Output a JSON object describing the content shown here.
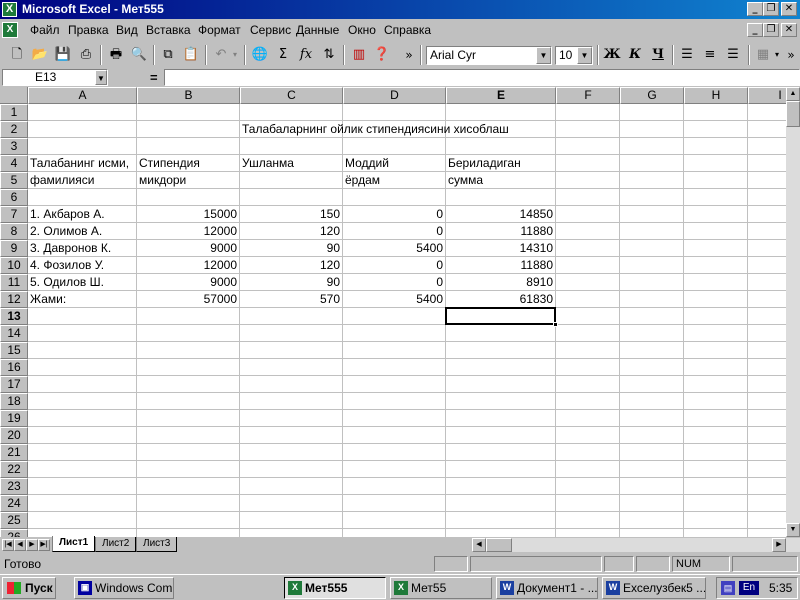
{
  "window": {
    "title": "Microsoft Excel - Мет555",
    "app_icon": "excel-icon",
    "controls": [
      "_",
      "❐",
      "✕"
    ]
  },
  "menu": {
    "items": [
      "Файл",
      "Правка",
      "Вид",
      "Вставка",
      "Формат",
      "Сервис",
      "Данные",
      "Окно",
      "Справка"
    ],
    "doc_controls": [
      "_",
      "❐",
      "✕"
    ]
  },
  "toolbar": {
    "font_name": "Arial Cyr",
    "font_size": "10",
    "bold_label": "Ж",
    "italic_label": "К",
    "underline_label": "Ч",
    "sigma_label": "Σ",
    "fx_label": "fx",
    "more_label": "»"
  },
  "formula_bar": {
    "name_box": "E13",
    "equals": "=",
    "value": ""
  },
  "sheet": {
    "columns": [
      "A",
      "B",
      "C",
      "D",
      "E",
      "F",
      "G",
      "H",
      "I"
    ],
    "rows": [
      "1",
      "2",
      "3",
      "4",
      "5",
      "6",
      "7",
      "8",
      "9",
      "10",
      "11",
      "12",
      "13",
      "14",
      "15",
      "16",
      "17",
      "18",
      "19",
      "20",
      "21",
      "22",
      "23",
      "24",
      "25",
      "26"
    ],
    "active_cell": "E13",
    "cells": {
      "C2": "Талабаларнинг ойлик стипендиясини хисоблаш",
      "A4": "Талабанинг исми,",
      "B4": "Стипендия",
      "C4": "Ушланма",
      "D4": "Моддий",
      "E4": "Бериладиган",
      "A5": "фамилияси",
      "B5": "микдори",
      "D5": "ёрдам",
      "E5": "сумма",
      "A7": "1. Акбаров А.",
      "B7": "15000",
      "C7": "150",
      "D7": "0",
      "E7": "14850",
      "A8": "2. Олимов А.",
      "B8": "12000",
      "C8": "120",
      "D8": "0",
      "E8": "11880",
      "A9": "3. Давронов К.",
      "B9": "9000",
      "C9": "90",
      "D9": "5400",
      "E9": "14310",
      "A10": "4. Фозилов У.",
      "B10": "12000",
      "C10": "120",
      "D10": "0",
      "E10": "11880",
      "A11": "5. Одилов Ш.",
      "B11": "9000",
      "C11": "90",
      "D11": "0",
      "E11": "8910",
      "A12": "Жами:",
      "B12": "57000",
      "C12": "570",
      "D12": "5400",
      "E12": "61830"
    }
  },
  "tabs": {
    "sheets": [
      "Лист1",
      "Лист2",
      "Лист3"
    ],
    "active": "Лист1"
  },
  "status": {
    "text": "Готово",
    "num": "NUM"
  },
  "taskbar": {
    "start": "Пуск",
    "buttons": [
      {
        "label": "Windows Com...",
        "icon": "windows-commander-icon"
      },
      {
        "label": "Мет555",
        "icon": "excel-icon",
        "active": true
      },
      {
        "label": "Мет55",
        "icon": "excel-icon"
      },
      {
        "label": "Документ1 - ...",
        "icon": "word-icon"
      },
      {
        "label": "Ехселузбек5 ...",
        "icon": "word-icon"
      }
    ],
    "language": "En",
    "clock": "5:35"
  }
}
